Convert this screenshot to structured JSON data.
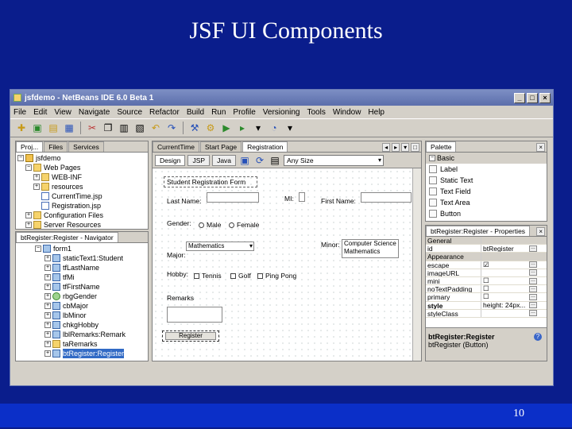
{
  "slide": {
    "title": "JSF UI Components",
    "page_number": "10"
  },
  "window": {
    "title": "jsfdemo - NetBeans IDE 6.0 Beta 1",
    "buttons": [
      "_",
      "□",
      "×"
    ]
  },
  "menu": [
    "File",
    "Edit",
    "View",
    "Navigate",
    "Source",
    "Refactor",
    "Build",
    "Run",
    "Profile",
    "Versioning",
    "Tools",
    "Window",
    "Help"
  ],
  "projects_panel": {
    "tabs": [
      "Proj...",
      "Files",
      "Services"
    ],
    "tree": [
      {
        "label": "jsfdemo",
        "indent": 0
      },
      {
        "label": "Web Pages",
        "indent": 1
      },
      {
        "label": "WEB-INF",
        "indent": 2
      },
      {
        "label": "resources",
        "indent": 2
      },
      {
        "label": "CurrentTime.jsp",
        "indent": 2
      },
      {
        "label": "Registration.jsp",
        "indent": 2
      },
      {
        "label": "Configuration Files",
        "indent": 1
      },
      {
        "label": "Server Resources",
        "indent": 1
      }
    ]
  },
  "navigator_panel": {
    "tabs": [
      "btRegister:Register - Navigator"
    ],
    "tree": [
      {
        "label": "form1",
        "indent": 2
      },
      {
        "label": "staticText1:Student",
        "indent": 3
      },
      {
        "label": "tfLastName",
        "indent": 3
      },
      {
        "label": "tfMi",
        "indent": 3
      },
      {
        "label": "tfFirstName",
        "indent": 3
      },
      {
        "label": "rbgGender",
        "indent": 3
      },
      {
        "label": "cbMajor",
        "indent": 3
      },
      {
        "label": "lbMinor",
        "indent": 3
      },
      {
        "label": "chkgHobby",
        "indent": 3
      },
      {
        "label": "lblRemarks:Remark",
        "indent": 3
      },
      {
        "label": "taRemarks",
        "indent": 3
      },
      {
        "label": "btRegister:Register",
        "indent": 3,
        "selected": true
      }
    ]
  },
  "editor": {
    "tabs": [
      "CurrentTime",
      "Start Page",
      "Registration"
    ],
    "view_buttons": [
      "Design",
      "JSP",
      "Java"
    ],
    "screen_size": "Any Size",
    "form": {
      "heading": "Student Registration Form",
      "last_name": "Last Name:",
      "mi": "MI:",
      "first_name": "First Name:",
      "gender": "Gender:",
      "male": "Male",
      "female": "Female",
      "major": "Major:",
      "major_value": "Mathematics",
      "minor": "Minor:",
      "minor_items": [
        "Computer Science",
        "Mathematics"
      ],
      "hobby": "Hobby:",
      "hobbies": [
        "Tennis",
        "Golf",
        "Ping Pong"
      ],
      "remarks": "Remarks",
      "register": "Register"
    }
  },
  "palette": {
    "tabs": [
      "Palette"
    ],
    "section": "Basic",
    "items": [
      "Label",
      "Static Text",
      "Text Field",
      "Text Area",
      "Button"
    ]
  },
  "properties": {
    "tabs": [
      "btRegister:Register - Properties"
    ],
    "rows": [
      {
        "name": "General",
        "value": "",
        "category": true
      },
      {
        "name": "id",
        "value": "btRegister"
      },
      {
        "name": "Appearance",
        "value": "",
        "category": true
      },
      {
        "name": "escape",
        "value": "☑"
      },
      {
        "name": "imageURL",
        "value": ""
      },
      {
        "name": "mini",
        "value": "☐"
      },
      {
        "name": "noTextPadding",
        "value": "☐"
      },
      {
        "name": "primary",
        "value": "☐"
      },
      {
        "name": "style",
        "value": "height: 24px..."
      },
      {
        "name": "styleClass",
        "value": ""
      }
    ],
    "footer_title": "btRegister:Register",
    "footer_sub": "btRegister (Button)"
  }
}
